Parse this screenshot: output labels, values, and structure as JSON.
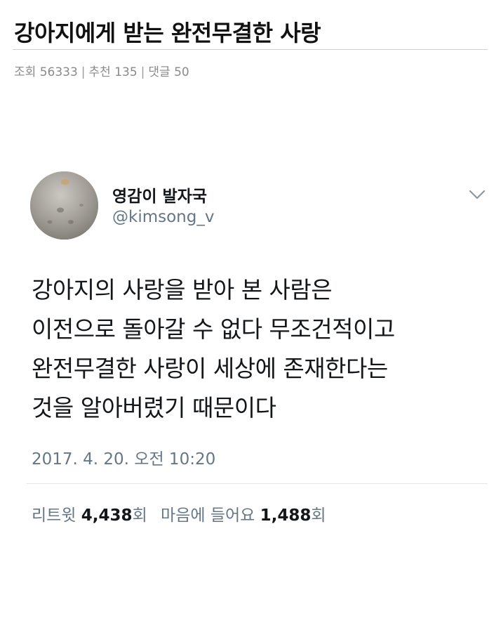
{
  "post": {
    "title": "강아지에게 받는 완전무결한 사랑",
    "meta": {
      "views_label": "조회",
      "views": "56333",
      "recommend_label": "추천",
      "recommend": "135",
      "comments_label": "댓글",
      "comments": "50",
      "separator": "|"
    }
  },
  "tweet": {
    "author_name": "영감이 발자국",
    "author_handle": "@kimsong_v",
    "text_lines": [
      "강아지의 사랑을 받아 본 사람은",
      "이전으로 돌아갈 수 없다 무조건적이고",
      "완전무결한 사랑이 세상에 존재한다는",
      "것을 알아버렸기 때문이다"
    ],
    "date": "2017. 4. 20. 오전 10:20",
    "stats": {
      "retweets_label": "리트윗",
      "retweets": "4,438",
      "retweets_unit": "회",
      "likes_label": "마음에 들어요",
      "likes": "1,488",
      "likes_unit": "회"
    },
    "menu_icon": "chevron-down-icon",
    "colors": {
      "name": "#14171a",
      "secondary": "#657786",
      "divider": "#e1e8ed"
    }
  }
}
